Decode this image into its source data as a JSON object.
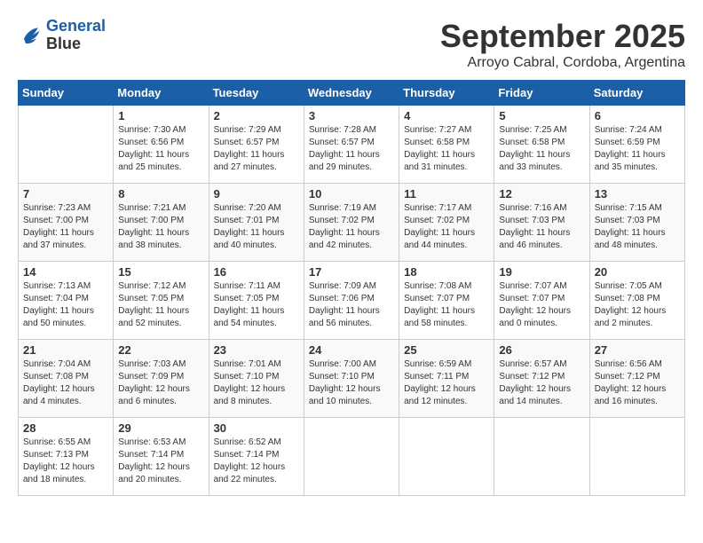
{
  "header": {
    "logo_line1": "General",
    "logo_line2": "Blue",
    "month_title": "September 2025",
    "location": "Arroyo Cabral, Cordoba, Argentina"
  },
  "weekdays": [
    "Sunday",
    "Monday",
    "Tuesday",
    "Wednesday",
    "Thursday",
    "Friday",
    "Saturday"
  ],
  "weeks": [
    [
      {
        "day": "",
        "info": ""
      },
      {
        "day": "1",
        "info": "Sunrise: 7:30 AM\nSunset: 6:56 PM\nDaylight: 11 hours\nand 25 minutes."
      },
      {
        "day": "2",
        "info": "Sunrise: 7:29 AM\nSunset: 6:57 PM\nDaylight: 11 hours\nand 27 minutes."
      },
      {
        "day": "3",
        "info": "Sunrise: 7:28 AM\nSunset: 6:57 PM\nDaylight: 11 hours\nand 29 minutes."
      },
      {
        "day": "4",
        "info": "Sunrise: 7:27 AM\nSunset: 6:58 PM\nDaylight: 11 hours\nand 31 minutes."
      },
      {
        "day": "5",
        "info": "Sunrise: 7:25 AM\nSunset: 6:58 PM\nDaylight: 11 hours\nand 33 minutes."
      },
      {
        "day": "6",
        "info": "Sunrise: 7:24 AM\nSunset: 6:59 PM\nDaylight: 11 hours\nand 35 minutes."
      }
    ],
    [
      {
        "day": "7",
        "info": "Sunrise: 7:23 AM\nSunset: 7:00 PM\nDaylight: 11 hours\nand 37 minutes."
      },
      {
        "day": "8",
        "info": "Sunrise: 7:21 AM\nSunset: 7:00 PM\nDaylight: 11 hours\nand 38 minutes."
      },
      {
        "day": "9",
        "info": "Sunrise: 7:20 AM\nSunset: 7:01 PM\nDaylight: 11 hours\nand 40 minutes."
      },
      {
        "day": "10",
        "info": "Sunrise: 7:19 AM\nSunset: 7:02 PM\nDaylight: 11 hours\nand 42 minutes."
      },
      {
        "day": "11",
        "info": "Sunrise: 7:17 AM\nSunset: 7:02 PM\nDaylight: 11 hours\nand 44 minutes."
      },
      {
        "day": "12",
        "info": "Sunrise: 7:16 AM\nSunset: 7:03 PM\nDaylight: 11 hours\nand 46 minutes."
      },
      {
        "day": "13",
        "info": "Sunrise: 7:15 AM\nSunset: 7:03 PM\nDaylight: 11 hours\nand 48 minutes."
      }
    ],
    [
      {
        "day": "14",
        "info": "Sunrise: 7:13 AM\nSunset: 7:04 PM\nDaylight: 11 hours\nand 50 minutes."
      },
      {
        "day": "15",
        "info": "Sunrise: 7:12 AM\nSunset: 7:05 PM\nDaylight: 11 hours\nand 52 minutes."
      },
      {
        "day": "16",
        "info": "Sunrise: 7:11 AM\nSunset: 7:05 PM\nDaylight: 11 hours\nand 54 minutes."
      },
      {
        "day": "17",
        "info": "Sunrise: 7:09 AM\nSunset: 7:06 PM\nDaylight: 11 hours\nand 56 minutes."
      },
      {
        "day": "18",
        "info": "Sunrise: 7:08 AM\nSunset: 7:07 PM\nDaylight: 11 hours\nand 58 minutes."
      },
      {
        "day": "19",
        "info": "Sunrise: 7:07 AM\nSunset: 7:07 PM\nDaylight: 12 hours\nand 0 minutes."
      },
      {
        "day": "20",
        "info": "Sunrise: 7:05 AM\nSunset: 7:08 PM\nDaylight: 12 hours\nand 2 minutes."
      }
    ],
    [
      {
        "day": "21",
        "info": "Sunrise: 7:04 AM\nSunset: 7:08 PM\nDaylight: 12 hours\nand 4 minutes."
      },
      {
        "day": "22",
        "info": "Sunrise: 7:03 AM\nSunset: 7:09 PM\nDaylight: 12 hours\nand 6 minutes."
      },
      {
        "day": "23",
        "info": "Sunrise: 7:01 AM\nSunset: 7:10 PM\nDaylight: 12 hours\nand 8 minutes."
      },
      {
        "day": "24",
        "info": "Sunrise: 7:00 AM\nSunset: 7:10 PM\nDaylight: 12 hours\nand 10 minutes."
      },
      {
        "day": "25",
        "info": "Sunrise: 6:59 AM\nSunset: 7:11 PM\nDaylight: 12 hours\nand 12 minutes."
      },
      {
        "day": "26",
        "info": "Sunrise: 6:57 AM\nSunset: 7:12 PM\nDaylight: 12 hours\nand 14 minutes."
      },
      {
        "day": "27",
        "info": "Sunrise: 6:56 AM\nSunset: 7:12 PM\nDaylight: 12 hours\nand 16 minutes."
      }
    ],
    [
      {
        "day": "28",
        "info": "Sunrise: 6:55 AM\nSunset: 7:13 PM\nDaylight: 12 hours\nand 18 minutes."
      },
      {
        "day": "29",
        "info": "Sunrise: 6:53 AM\nSunset: 7:14 PM\nDaylight: 12 hours\nand 20 minutes."
      },
      {
        "day": "30",
        "info": "Sunrise: 6:52 AM\nSunset: 7:14 PM\nDaylight: 12 hours\nand 22 minutes."
      },
      {
        "day": "",
        "info": ""
      },
      {
        "day": "",
        "info": ""
      },
      {
        "day": "",
        "info": ""
      },
      {
        "day": "",
        "info": ""
      }
    ]
  ]
}
